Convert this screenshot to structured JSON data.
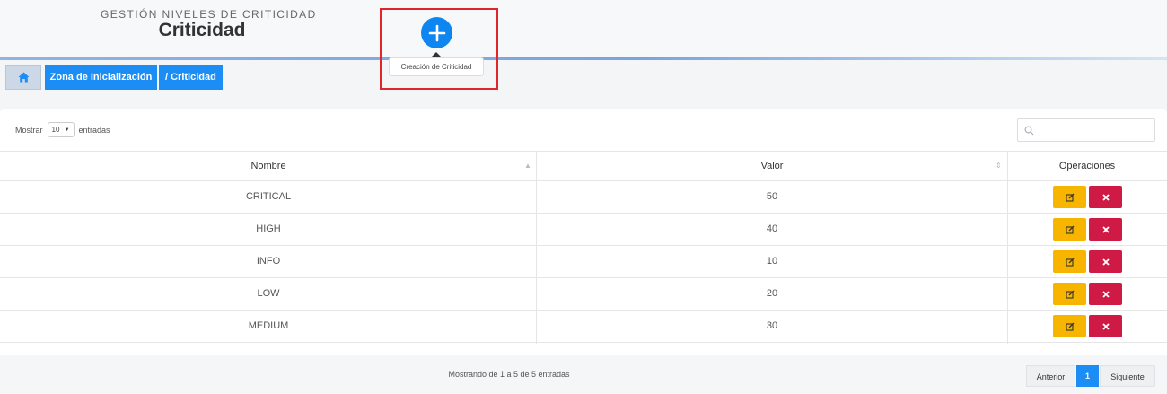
{
  "header": {
    "subtitle": "GESTIÓN NIVELES DE CRITICIDAD",
    "title": "Criticidad",
    "add_tooltip": "Creación de Criticidad"
  },
  "breadcrumb": {
    "home_icon": "home-icon",
    "items": [
      "Zona de Inicialización",
      "/ Criticidad"
    ]
  },
  "table_controls": {
    "length_prefix": "Mostrar",
    "length_value": "10",
    "length_suffix": "entradas",
    "search_placeholder": "",
    "search_icon": "search-icon"
  },
  "table": {
    "headers": [
      "Nombre",
      "Valor",
      "Operaciones"
    ],
    "rows": [
      {
        "nombre": "CRITICAL",
        "valor": "50"
      },
      {
        "nombre": "HIGH",
        "valor": "40"
      },
      {
        "nombre": "INFO",
        "valor": "10"
      },
      {
        "nombre": "LOW",
        "valor": "20"
      },
      {
        "nombre": "MEDIUM",
        "valor": "30"
      }
    ],
    "edit_icon": "edit-icon",
    "delete_icon": "close-icon"
  },
  "footer": {
    "info": "Mostrando de 1 a 5 de 5 entradas",
    "prev": "Anterior",
    "page": "1",
    "next": "Siguiente"
  },
  "colors": {
    "primary": "#1c8df4",
    "edit": "#f7b500",
    "delete": "#cf1a45",
    "highlight": "#e0262b"
  }
}
